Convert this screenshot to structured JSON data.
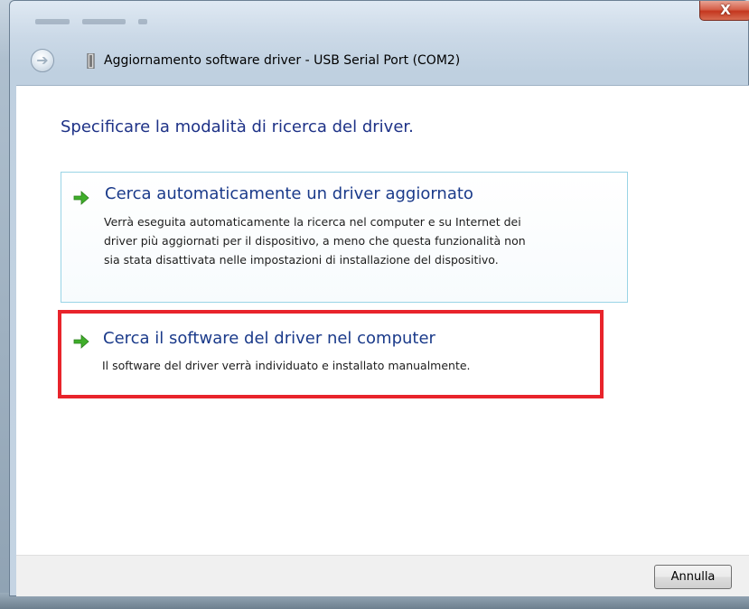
{
  "window": {
    "title": "Aggiornamento software driver - USB Serial Port (COM2)",
    "close_label": "X"
  },
  "content": {
    "heading": "Specificare la modalità di ricerca del driver.",
    "options": [
      {
        "title": "Cerca automaticamente un driver aggiornato",
        "desc_lines": [
          "Verrà eseguita automaticamente la ricerca nel computer e su Internet dei",
          "driver più aggiornati per il dispositivo, a meno che questa funzionalità non",
          "sia stata disattivata nelle impostazioni di installazione del dispositivo."
        ],
        "icon": "green-arrow-icon"
      },
      {
        "title": "Cerca il software del driver nel computer",
        "desc_lines": [
          "Il software del driver verrà individuato e installato manualmente."
        ],
        "icon": "green-arrow-icon",
        "highlight_color": "#e8242b"
      }
    ]
  },
  "footer": {
    "cancel_label": "Annulla"
  },
  "colors": {
    "heading": "#1e3287",
    "option_title": "#1a3a8a",
    "arrow": "#3fae2a",
    "highlight": "#e8242b"
  }
}
